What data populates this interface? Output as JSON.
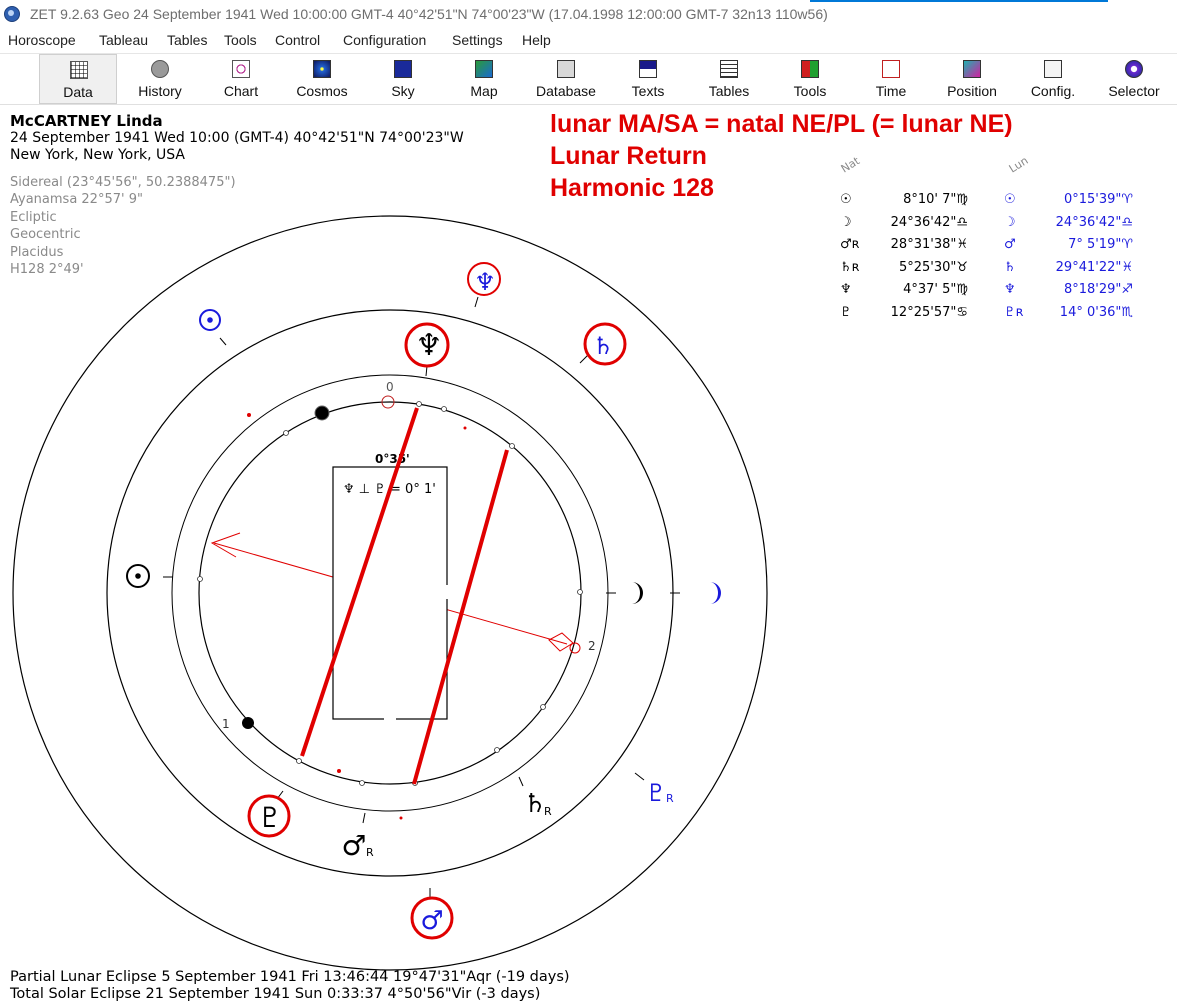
{
  "window": {
    "title": "ZET 9.2.63 Geo   24 September 1941  Wed  10:00:00 GMT-4 40°42'51\"N  74°00'23\"W  (17.04.1998  12:00:00 GMT-7 32n13 110w56)"
  },
  "menu": [
    "Horoscope",
    "Tableau",
    "Tables",
    "Tools",
    "Control",
    "Configuration",
    "Settings",
    "Help"
  ],
  "toolbar": {
    "active": "Data",
    "items": [
      {
        "label": "Data",
        "icon": "grid-icon"
      },
      {
        "label": "History",
        "icon": "history-icon"
      },
      {
        "label": "Chart",
        "icon": "chart-wheel-icon"
      },
      {
        "label": "Cosmos",
        "icon": "cosmos-icon"
      },
      {
        "label": "Sky",
        "icon": "sky-icon"
      },
      {
        "label": "Map",
        "icon": "map-icon"
      },
      {
        "label": "Database",
        "icon": "database-icon"
      },
      {
        "label": "Texts",
        "icon": "texts-icon"
      },
      {
        "label": "Tables",
        "icon": "tables-icon"
      },
      {
        "label": "Tools",
        "icon": "tools-icon"
      },
      {
        "label": "Time",
        "icon": "time-icon"
      },
      {
        "label": "Position",
        "icon": "position-icon"
      },
      {
        "label": "Config.",
        "icon": "config-icon"
      },
      {
        "label": "Selector",
        "icon": "selector-icon"
      }
    ]
  },
  "chart_info": {
    "name": "McCARTNEY Linda",
    "datetime": "24 September 1941  Wed  10:00 (GMT-4) 40°42'51\"N  74°00'23\"W",
    "place": "New York, New York, USA",
    "settings": [
      "Sidereal (23°45'56\", 50.2388475\")",
      "Ayanamsa 22°57' 9\"",
      "Ecliptic",
      "Geocentric",
      "Placidus",
      "H128   2°49'"
    ]
  },
  "headline": [
    "lunar MA/SA = natal NE/PL (= lunar NE)",
    "Lunar Return",
    "Harmonic 128"
  ],
  "colors": {
    "natal": "#000000",
    "lunar": "#1a1adc",
    "highlight": "#e00000",
    "title_red": "#e00000"
  },
  "positions": {
    "nat_header": "Nat",
    "lun_header": "Lun",
    "rows": [
      {
        "nat_glyph": "☉",
        "nat_value": "8°10' 7\"♍",
        "lun_glyph": "☉",
        "lun_value": "0°15'39\"♈"
      },
      {
        "nat_glyph": "☽",
        "nat_value": "24°36'42\"♎",
        "lun_glyph": "☽",
        "lun_value": "24°36'42\"♎"
      },
      {
        "nat_glyph": "♂ʀ",
        "nat_value": "28°31'38\"♓",
        "lun_glyph": "♂",
        "lun_value": "7° 5'19\"♈"
      },
      {
        "nat_glyph": "♄ʀ",
        "nat_value": "5°25'30\"♉",
        "lun_glyph": "♄",
        "lun_value": "29°41'22\"♓"
      },
      {
        "nat_glyph": "♆",
        "nat_value": "4°37' 5\"♍",
        "lun_glyph": "♆",
        "lun_value": "8°18'29\"♐"
      },
      {
        "nat_glyph": "♇",
        "nat_value": "12°25'57\"♋",
        "lun_glyph": "♇ʀ",
        "lun_value": "14° 0'36\"♏"
      }
    ]
  },
  "wheel": {
    "top_label": "0°35'",
    "box_text": "♆ ⊥ ♇ = 0° 1'",
    "house_cusp_label_1": "1",
    "house_cusp_label_2": "2",
    "mc_label": "0",
    "retro_marker": "R"
  },
  "footer": [
    "Partial Lunar Eclipse 5 September 1941 Fri 13:46:44 19°47'31\"Aqr (-19 days)",
    "Total Solar Eclipse 21 September 1941 Sun  0:33:37  4°50'56\"Vir (-3 days)"
  ]
}
